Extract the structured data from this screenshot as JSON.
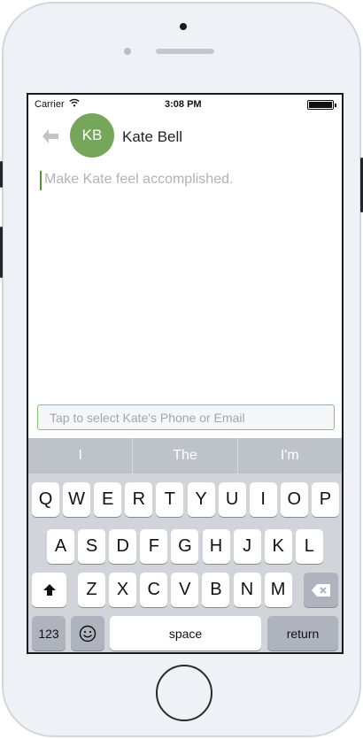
{
  "status_bar": {
    "carrier": "Carrier",
    "time": "3:08 PM",
    "battery_level": 1.0
  },
  "header": {
    "avatar_initials": "KB",
    "contact_name": "Kate Bell"
  },
  "message": {
    "placeholder": "Make Kate feel accomplished."
  },
  "contact_select": {
    "placeholder": "Tap to select Kate's Phone or Email"
  },
  "predictions": [
    "I",
    "The",
    "I'm"
  ],
  "keyboard": {
    "row1": [
      "Q",
      "W",
      "E",
      "R",
      "T",
      "Y",
      "U",
      "I",
      "O",
      "P"
    ],
    "row2": [
      "A",
      "S",
      "D",
      "F",
      "G",
      "H",
      "J",
      "K",
      "L"
    ],
    "row3": [
      "Z",
      "X",
      "C",
      "V",
      "B",
      "N",
      "M"
    ],
    "numbers_label": "123",
    "space_label": "space",
    "return_label": "return"
  },
  "colors": {
    "avatar": "#76a65a",
    "accent": "#8cc07a",
    "keyboard_bg": "#d1d4d9"
  }
}
